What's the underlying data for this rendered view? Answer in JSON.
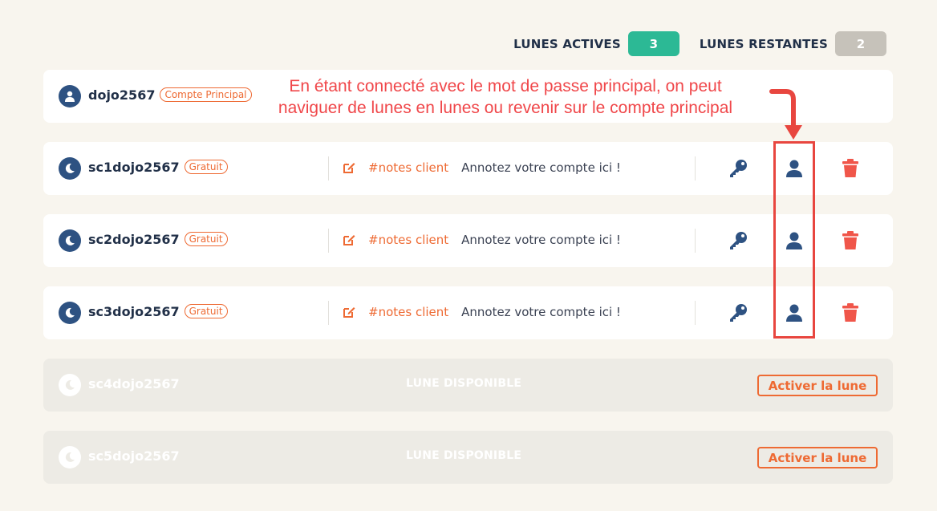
{
  "stats": {
    "active_label": "LUNES ACTIVES",
    "active_count": "3",
    "remaining_label": "LUNES RESTANTES",
    "remaining_count": "2"
  },
  "main_account": {
    "name": "dojo2567",
    "tag": "Compte Principal"
  },
  "moons": [
    {
      "name": "sc1dojo2567",
      "tag": "Gratuit",
      "notes_label": "#notes client",
      "notes_text": "Annotez votre compte ici !"
    },
    {
      "name": "sc2dojo2567",
      "tag": "Gratuit",
      "notes_label": "#notes client",
      "notes_text": "Annotez votre compte ici !"
    },
    {
      "name": "sc3dojo2567",
      "tag": "Gratuit",
      "notes_label": "#notes client",
      "notes_text": "Annotez votre compte ici !"
    }
  ],
  "available_moons": [
    {
      "name": "sc4dojo2567",
      "status": "LUNE DISPONIBLE",
      "action": "Activer la lune"
    },
    {
      "name": "sc5dojo2567",
      "status": "LUNE DISPONIBLE",
      "action": "Activer la lune"
    }
  ],
  "annotation": {
    "line1": "En étant connecté avec le mot de passe principal, on peut",
    "line2": "naviguer de lunes en lunes ou revenir sur le compte principal"
  },
  "colors": {
    "accent_orange": "#ee6a33",
    "active_green": "#2cb995",
    "remaining_grey": "#c6c2ba",
    "icon_blue": "#2e5282",
    "delete_red": "#f0564a",
    "annotation_red": "#f0474a"
  },
  "icons": {
    "avatar_main": "user-icon",
    "avatar_moon": "moon-icon",
    "edit": "edit-icon",
    "key": "key-icon",
    "switch": "user-icon",
    "delete": "trash-icon"
  }
}
